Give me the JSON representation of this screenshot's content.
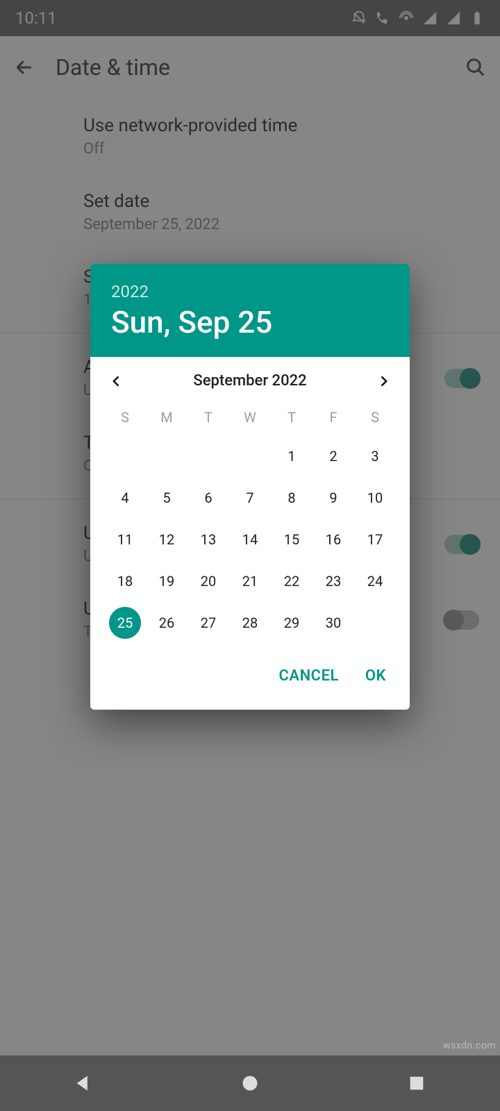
{
  "status": {
    "time": "10:11"
  },
  "appbar": {
    "title": "Date & time"
  },
  "settings": {
    "network_time": {
      "title": "Use network-provided time",
      "value": "Off"
    },
    "set_date": {
      "title": "Set date",
      "value": "September 25, 2022"
    },
    "set_time": {
      "title": "S",
      "value": "1"
    },
    "auto_tz": {
      "title": "A",
      "value": "U"
    },
    "time_zone": {
      "title": "T",
      "value": "C"
    },
    "locale_def": {
      "title": "U",
      "value": "U"
    },
    "use_24h": {
      "title": "U",
      "value": "T"
    }
  },
  "datepicker": {
    "year": "2022",
    "headline": "Sun, Sep 25",
    "month_label": "September 2022",
    "weekdays": [
      "S",
      "M",
      "T",
      "W",
      "T",
      "F",
      "S"
    ],
    "weeks": [
      [
        "",
        "",
        "",
        "",
        "1",
        "2",
        "3"
      ],
      [
        "4",
        "5",
        "6",
        "7",
        "8",
        "9",
        "10"
      ],
      [
        "11",
        "12",
        "13",
        "14",
        "15",
        "16",
        "17"
      ],
      [
        "18",
        "19",
        "20",
        "21",
        "22",
        "23",
        "24"
      ],
      [
        "25",
        "26",
        "27",
        "28",
        "29",
        "30",
        ""
      ]
    ],
    "selected_day": "25",
    "actions": {
      "cancel": "CANCEL",
      "ok": "OK"
    }
  },
  "colors": {
    "accent": "#009688",
    "highlight": "#e60000"
  },
  "watermark": "wsxdn.com"
}
